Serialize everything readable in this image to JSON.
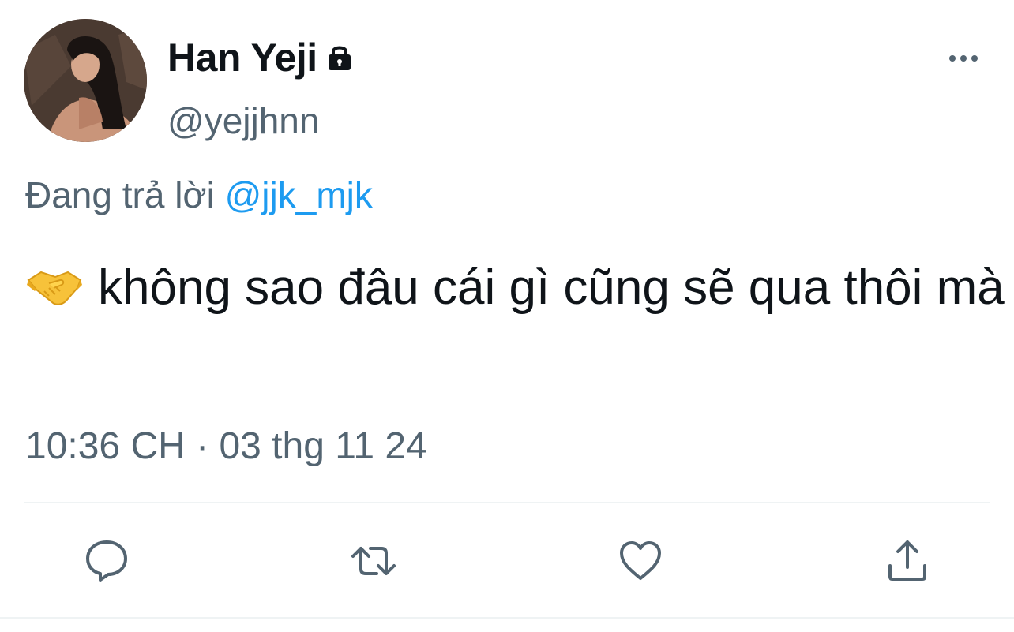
{
  "author": {
    "display_name": "Han Yeji",
    "handle": "@yejjhnn",
    "protected_icon": "lock-icon",
    "avatar": "profile-photo"
  },
  "reply": {
    "prefix": "Đang trả lời",
    "mention": "@jjk_mjk"
  },
  "tweet": {
    "emoji": "handshake-emoji",
    "text": "không sao đâu cái gì cũng sẽ qua thôi mà",
    "timestamp": "10:36 CH · 03 thg 11 24"
  },
  "actions": [
    {
      "name": "reply",
      "icon": "speech-bubble-icon"
    },
    {
      "name": "retweet",
      "icon": "retweet-icon"
    },
    {
      "name": "like",
      "icon": "heart-icon"
    },
    {
      "name": "share",
      "icon": "share-icon"
    }
  ],
  "menu_icon": "more-horizontal-icon",
  "colors": {
    "text": "#0f1419",
    "secondary": "#536471",
    "link": "#1d9bf0",
    "divider": "#eff3f4"
  }
}
